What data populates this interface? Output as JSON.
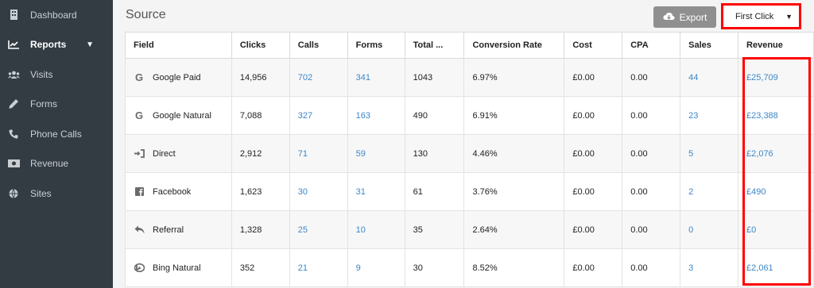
{
  "sidebar": {
    "items": [
      {
        "label": "Dashboard",
        "icon": "dashboard-icon"
      },
      {
        "label": "Reports",
        "icon": "reports-chart-icon",
        "active": true
      },
      {
        "label": "Visits",
        "icon": "users-icon"
      },
      {
        "label": "Forms",
        "icon": "pencil-icon"
      },
      {
        "label": "Phone Calls",
        "icon": "phone-icon"
      },
      {
        "label": "Revenue",
        "icon": "money-icon"
      },
      {
        "label": "Sites",
        "icon": "globe-icon"
      }
    ]
  },
  "header": {
    "title": "Source",
    "export_label": "Export",
    "attribution_selected": "First Click"
  },
  "table": {
    "columns": [
      "Field",
      "Clicks",
      "Calls",
      "Forms",
      "Total ...",
      "Conversion Rate",
      "Cost",
      "CPA",
      "Sales",
      "Revenue"
    ],
    "rows": [
      {
        "field": "Google Paid",
        "icon": "google-icon",
        "clicks": "14,956",
        "calls": "702",
        "forms": "341",
        "total": "1043",
        "conversion_rate": "6.97%",
        "cost": "£0.00",
        "cpa": "0.00",
        "sales": "44",
        "revenue": "£25,709"
      },
      {
        "field": "Google Natural",
        "icon": "google-icon",
        "clicks": "7,088",
        "calls": "327",
        "forms": "163",
        "total": "490",
        "conversion_rate": "6.91%",
        "cost": "£0.00",
        "cpa": "0.00",
        "sales": "23",
        "revenue": "£23,388"
      },
      {
        "field": "Direct",
        "icon": "sign-in-icon",
        "clicks": "2,912",
        "calls": "71",
        "forms": "59",
        "total": "130",
        "conversion_rate": "4.46%",
        "cost": "£0.00",
        "cpa": "0.00",
        "sales": "5",
        "revenue": "£2,076"
      },
      {
        "field": "Facebook",
        "icon": "facebook-icon",
        "clicks": "1,623",
        "calls": "30",
        "forms": "31",
        "total": "61",
        "conversion_rate": "3.76%",
        "cost": "£0.00",
        "cpa": "0.00",
        "sales": "2",
        "revenue": "£490"
      },
      {
        "field": "Referral",
        "icon": "reply-arrow-icon",
        "clicks": "1,328",
        "calls": "25",
        "forms": "10",
        "total": "35",
        "conversion_rate": "2.64%",
        "cost": "£0.00",
        "cpa": "0.00",
        "sales": "0",
        "revenue": "£0"
      },
      {
        "field": "Bing Natural",
        "icon": "bing-icon",
        "clicks": "352",
        "calls": "21",
        "forms": "9",
        "total": "30",
        "conversion_rate": "8.52%",
        "cost": "£0.00",
        "cpa": "0.00",
        "sales": "3",
        "revenue": "£2,061"
      }
    ]
  },
  "colors": {
    "sidebar_bg": "#333c43",
    "link": "#3d87c7",
    "highlight": "#ff0000",
    "export_button": "#8f8f8f"
  }
}
